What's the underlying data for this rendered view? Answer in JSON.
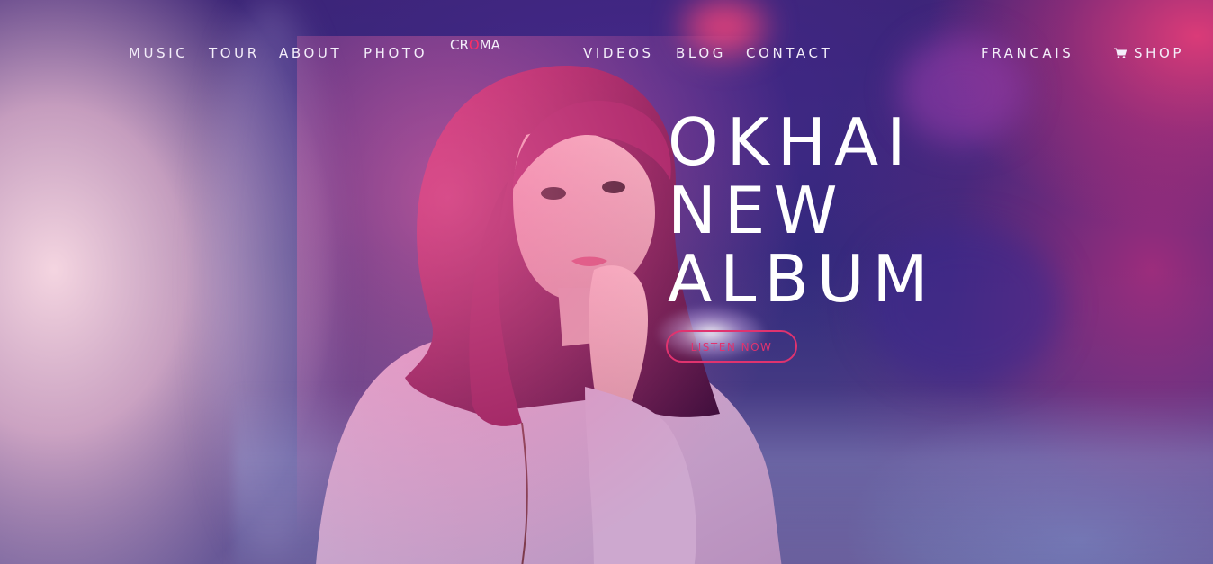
{
  "brand": {
    "logo_left": "CR",
    "logo_o": "O",
    "logo_right": "MA",
    "accent_color": "#ff2e63"
  },
  "nav": {
    "left_items": [
      {
        "label": "MUSIC"
      },
      {
        "label": "TOUR"
      },
      {
        "label": "ABOUT"
      },
      {
        "label": "PHOTO"
      }
    ],
    "right_items": [
      {
        "label": "VIDEOS"
      },
      {
        "label": "BLOG"
      },
      {
        "label": "CONTACT"
      }
    ],
    "language": "FRANCAIS",
    "shop": {
      "label": "SHOP",
      "icon": "cart-icon"
    }
  },
  "hero": {
    "headline_lines": [
      "OKHAI",
      "NEW",
      "ALBUM"
    ],
    "cta_label": "LISTEN NOW",
    "cta_color": "#e0336f"
  }
}
